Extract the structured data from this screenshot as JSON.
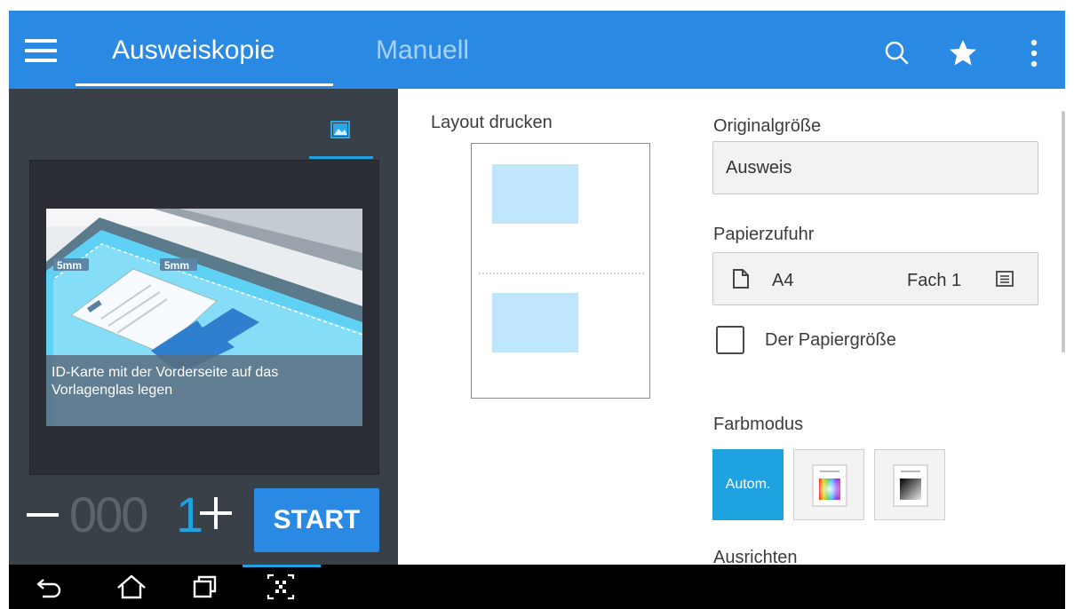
{
  "appbar": {
    "tabs": [
      {
        "label": "Ausweiskopie",
        "active": true
      },
      {
        "label": "Manuell",
        "active": false
      }
    ],
    "icons": [
      "menu-icon",
      "search-icon",
      "star-icon",
      "more-vertical-icon"
    ],
    "color": "#2a8ae3"
  },
  "preview": {
    "tab_icon": "image-icon",
    "illustration_labels": [
      "5mm",
      "5mm"
    ],
    "caption": "ID-Karte mit der Vorderseite auf das Vorlagenglas legen"
  },
  "counter": {
    "zeros": "000",
    "digit": "1",
    "start_label": "START"
  },
  "settings": {
    "layout_label": "Layout drucken",
    "original_size_label": "Originalgröße",
    "original_size_value": "Ausweis",
    "paper_feed_label": "Papierzufuhr",
    "paper_size": "A4",
    "paper_tray": "Fach 1",
    "fit_checkbox_label": "Der Papiergröße",
    "fit_checkbox_checked": false,
    "color_mode_label": "Farbmodus",
    "color_mode_options": [
      {
        "label": "Autom.",
        "selected": true
      },
      {
        "icon": "color-icon",
        "selected": false
      },
      {
        "icon": "grayscale-icon",
        "selected": false
      }
    ],
    "orientation_label": "Ausrichten"
  },
  "navbar": {
    "icons": [
      "back-icon",
      "home-icon",
      "recent-apps-icon",
      "screenshot-icon"
    ]
  },
  "colors": {
    "accent": "#1fa2e0",
    "panel": "#3a4048",
    "card_fill": "#bfe6fb"
  }
}
